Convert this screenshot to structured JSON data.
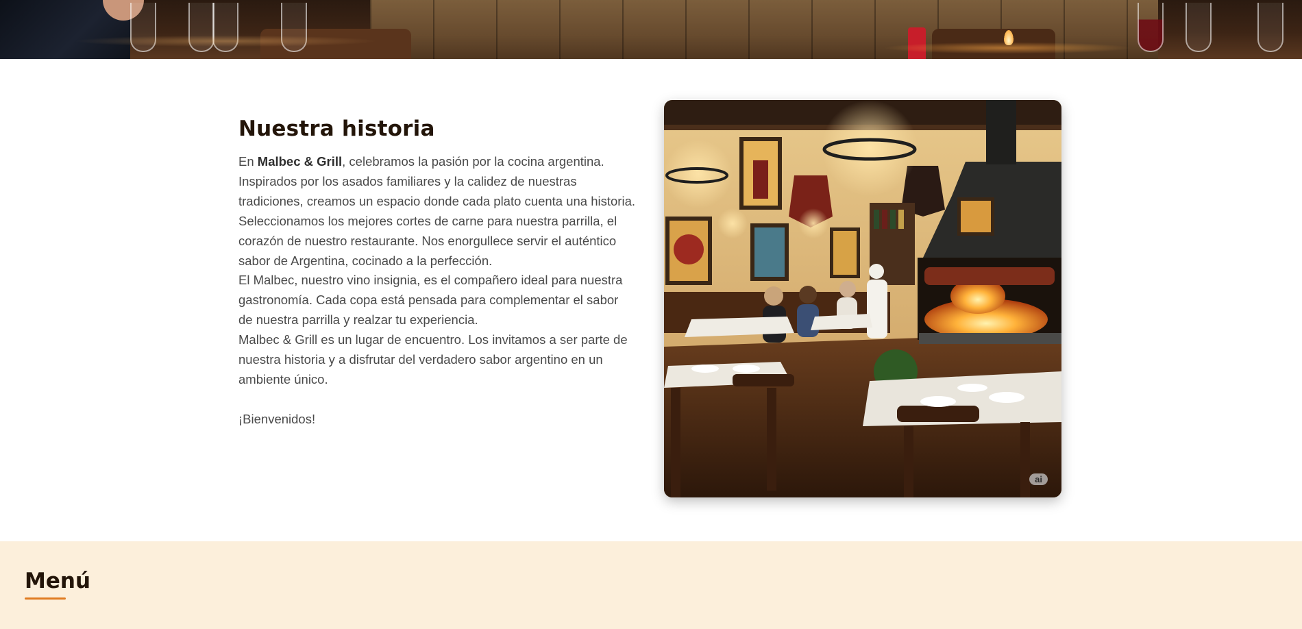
{
  "story": {
    "title": "Nuestra historia",
    "p1_prefix": "En ",
    "p1_brand": "Malbec & Grill",
    "p1_rest": ", celebramos la pasión por la cocina argentina. Inspirados por los asados familiares y la calidez de nuestras tradiciones, creamos un espacio donde cada plato cuenta una historia.",
    "p2": "Seleccionamos los mejores cortes de carne para nuestra parrilla, el corazón de nuestro restaurante. Nos enorgullece servir el auténtico sabor de Argentina, cocinado a la perfección.",
    "p3": "El Malbec, nuestro vino insignia, es el compañero ideal para nuestra gastronomía. Cada copa está pensada para complementar el sabor de nuestra parrilla y realzar tu experiencia.",
    "p4": "Malbec & Grill es un lugar de encuentro. Los invitamos a ser parte de nuestra historia y a disfrutar del verdadero sabor argentino en un ambiente único.",
    "welcome": "¡Bienvenidos!",
    "image_badge": "ai"
  },
  "menu": {
    "title": "Menú"
  },
  "colors": {
    "accent": "#e07a1f",
    "menu_background": "#fcefdb",
    "heading": "#231509",
    "body_text": "#4a4a4a"
  }
}
